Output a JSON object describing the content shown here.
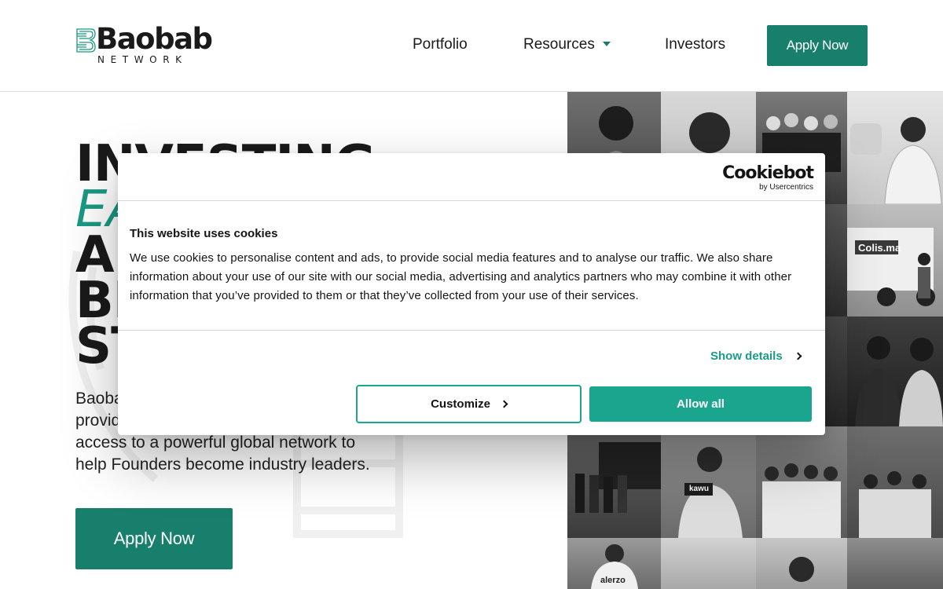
{
  "header": {
    "logo_name": "Baobab",
    "logo_sub": "NETWORK",
    "nav": {
      "portfolio": "Portfolio",
      "resources": "Resources",
      "investors": "Investors"
    },
    "apply_label": "Apply Now"
  },
  "hero": {
    "headline_line1": "INVESTING",
    "headline_line2": "EA",
    "headline_line3": "AI",
    "headline_line4": "BI",
    "headline_line5": "ST",
    "description": "Baobab provides capital and access to a powerful global network to help Founders become industry leaders.",
    "description_visible_l1": "Baoba",
    "description_visible_l2": "provid",
    "description_visible_l3": "access to a powerful global network to",
    "description_visible_l4": "help Founders become industry leaders.",
    "apply_label": "Apply Now"
  },
  "photos": {
    "colis_label": "Colis.ma",
    "kawu_label": "kawu",
    "alerzo_label": "alerzo"
  },
  "cookie": {
    "logo_main": "Cookiebot",
    "logo_by": "by Usercentrics",
    "title": "This website uses cookies",
    "text": "We use cookies to personalise content and ads, to provide social media features and to analyse our traffic. We also share information about your use of our site with our social media, advertising and analytics partners who may combine it with other information that you’ve provided to them or that they’ve collected from your use of their services.",
    "show_details": "Show details",
    "customize": "Customize",
    "allow_all": "Allow all"
  },
  "colors": {
    "brand": "#177f6c",
    "accent_text": "#1a9a82",
    "cookie_accent": "#1aa58f"
  }
}
